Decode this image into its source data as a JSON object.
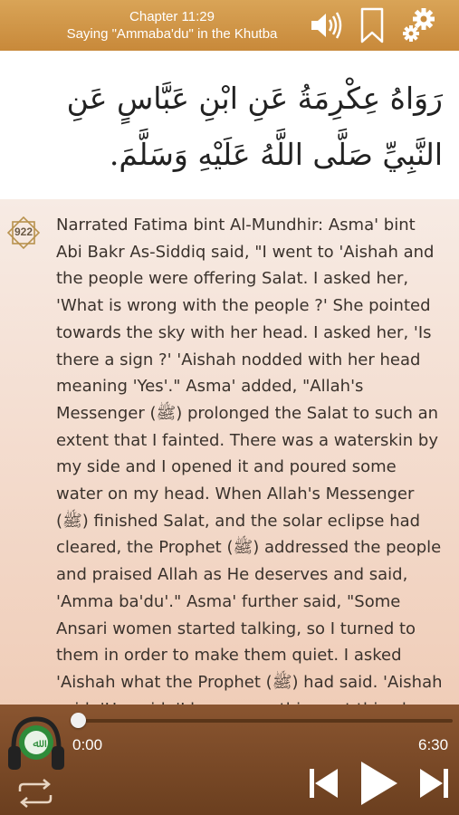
{
  "header": {
    "chapter": "Chapter 11:29",
    "subtitle": "Saying \"Ammaba'du\" in the Khutba",
    "icons": [
      "speaker-icon",
      "bookmark-icon",
      "gear-icon"
    ]
  },
  "arabic_text": "رَوَاهُ عِكْرِمَةُ عَنِ ابْنِ عَبَّاسٍ عَنِ النَّبِيِّ صَلَّى اللَّهُ عَلَيْهِ وَسَلَّمَ.",
  "hadith": {
    "number": "922",
    "text": "Narrated Fatima bint Al-Mundhir: Asma' bint Abi Bakr As-Siddiq said, \"I went to 'Aishah and the people were offering Salat. I asked her, 'What is wrong with the people ?' She pointed towards the sky with her head. I asked her, 'Is there a sign ?' 'Aishah nodded with her head meaning 'Yes'.\" Asma' added, \"Allah's Messenger (ﷺ) prolonged the Salat to such an extent that I fainted. There was a waterskin by my side and I opened it and poured some water on my head. When Allah's Messenger (ﷺ) finished Salat, and the solar eclipse had cleared, the Prophet (ﷺ) addressed the people and praised Allah as He deserves and said, 'Amma ba'du'.\" Asma' further said, \"Some Ansari women started talking, so I turned to them in order to make them quiet. I asked 'Aishah what the Prophet (ﷺ) had said. 'Aishah said: 'He said, 'I have seen things at this place of mine"
  },
  "player": {
    "current_time": "0:00",
    "total_time": "6:30",
    "progress": 0,
    "icons": [
      "headphones-icon",
      "repeat-icon",
      "previous-icon",
      "play-icon",
      "next-icon"
    ]
  }
}
